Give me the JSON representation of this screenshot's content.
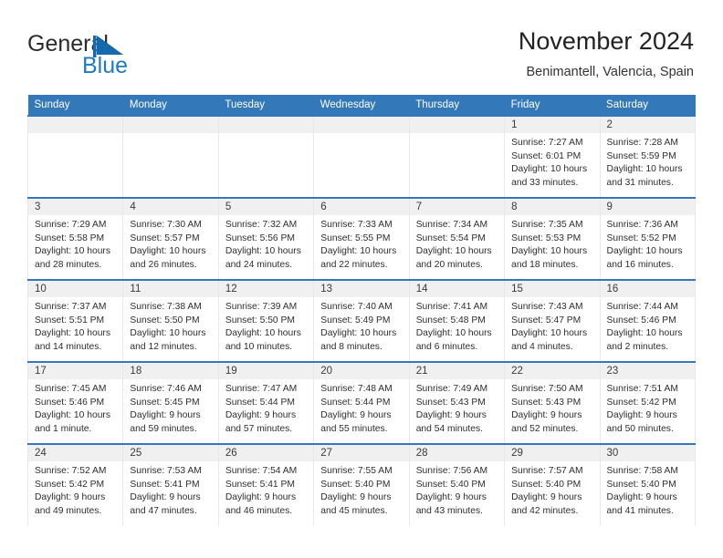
{
  "brand": {
    "name_part1": "General",
    "name_part2": "Blue",
    "accent_color": "#1f7bc1",
    "flag_icon": "blue-triangle-flag-icon"
  },
  "header": {
    "title": "November 2024",
    "subtitle": "Benimantell, Valencia, Spain"
  },
  "theme": {
    "header_blue": "#3378b8",
    "daynum_band": "#f0f0f0",
    "cell_border": "#e8e8e8",
    "text": "#2e2e2e"
  },
  "weekday_headers": [
    "Sunday",
    "Monday",
    "Tuesday",
    "Wednesday",
    "Thursday",
    "Friday",
    "Saturday"
  ],
  "weeks": [
    [
      {
        "empty": true
      },
      {
        "empty": true
      },
      {
        "empty": true
      },
      {
        "empty": true
      },
      {
        "empty": true
      },
      {
        "day": "1",
        "sunrise": "Sunrise: 7:27 AM",
        "sunset": "Sunset: 6:01 PM",
        "daylight_1": "Daylight: 10 hours",
        "daylight_2": "and 33 minutes."
      },
      {
        "day": "2",
        "sunrise": "Sunrise: 7:28 AM",
        "sunset": "Sunset: 5:59 PM",
        "daylight_1": "Daylight: 10 hours",
        "daylight_2": "and 31 minutes."
      }
    ],
    [
      {
        "day": "3",
        "sunrise": "Sunrise: 7:29 AM",
        "sunset": "Sunset: 5:58 PM",
        "daylight_1": "Daylight: 10 hours",
        "daylight_2": "and 28 minutes."
      },
      {
        "day": "4",
        "sunrise": "Sunrise: 7:30 AM",
        "sunset": "Sunset: 5:57 PM",
        "daylight_1": "Daylight: 10 hours",
        "daylight_2": "and 26 minutes."
      },
      {
        "day": "5",
        "sunrise": "Sunrise: 7:32 AM",
        "sunset": "Sunset: 5:56 PM",
        "daylight_1": "Daylight: 10 hours",
        "daylight_2": "and 24 minutes."
      },
      {
        "day": "6",
        "sunrise": "Sunrise: 7:33 AM",
        "sunset": "Sunset: 5:55 PM",
        "daylight_1": "Daylight: 10 hours",
        "daylight_2": "and 22 minutes."
      },
      {
        "day": "7",
        "sunrise": "Sunrise: 7:34 AM",
        "sunset": "Sunset: 5:54 PM",
        "daylight_1": "Daylight: 10 hours",
        "daylight_2": "and 20 minutes."
      },
      {
        "day": "8",
        "sunrise": "Sunrise: 7:35 AM",
        "sunset": "Sunset: 5:53 PM",
        "daylight_1": "Daylight: 10 hours",
        "daylight_2": "and 18 minutes."
      },
      {
        "day": "9",
        "sunrise": "Sunrise: 7:36 AM",
        "sunset": "Sunset: 5:52 PM",
        "daylight_1": "Daylight: 10 hours",
        "daylight_2": "and 16 minutes."
      }
    ],
    [
      {
        "day": "10",
        "sunrise": "Sunrise: 7:37 AM",
        "sunset": "Sunset: 5:51 PM",
        "daylight_1": "Daylight: 10 hours",
        "daylight_2": "and 14 minutes."
      },
      {
        "day": "11",
        "sunrise": "Sunrise: 7:38 AM",
        "sunset": "Sunset: 5:50 PM",
        "daylight_1": "Daylight: 10 hours",
        "daylight_2": "and 12 minutes."
      },
      {
        "day": "12",
        "sunrise": "Sunrise: 7:39 AM",
        "sunset": "Sunset: 5:50 PM",
        "daylight_1": "Daylight: 10 hours",
        "daylight_2": "and 10 minutes."
      },
      {
        "day": "13",
        "sunrise": "Sunrise: 7:40 AM",
        "sunset": "Sunset: 5:49 PM",
        "daylight_1": "Daylight: 10 hours",
        "daylight_2": "and 8 minutes."
      },
      {
        "day": "14",
        "sunrise": "Sunrise: 7:41 AM",
        "sunset": "Sunset: 5:48 PM",
        "daylight_1": "Daylight: 10 hours",
        "daylight_2": "and 6 minutes."
      },
      {
        "day": "15",
        "sunrise": "Sunrise: 7:43 AM",
        "sunset": "Sunset: 5:47 PM",
        "daylight_1": "Daylight: 10 hours",
        "daylight_2": "and 4 minutes."
      },
      {
        "day": "16",
        "sunrise": "Sunrise: 7:44 AM",
        "sunset": "Sunset: 5:46 PM",
        "daylight_1": "Daylight: 10 hours",
        "daylight_2": "and 2 minutes."
      }
    ],
    [
      {
        "day": "17",
        "sunrise": "Sunrise: 7:45 AM",
        "sunset": "Sunset: 5:46 PM",
        "daylight_1": "Daylight: 10 hours",
        "daylight_2": "and 1 minute."
      },
      {
        "day": "18",
        "sunrise": "Sunrise: 7:46 AM",
        "sunset": "Sunset: 5:45 PM",
        "daylight_1": "Daylight: 9 hours",
        "daylight_2": "and 59 minutes."
      },
      {
        "day": "19",
        "sunrise": "Sunrise: 7:47 AM",
        "sunset": "Sunset: 5:44 PM",
        "daylight_1": "Daylight: 9 hours",
        "daylight_2": "and 57 minutes."
      },
      {
        "day": "20",
        "sunrise": "Sunrise: 7:48 AM",
        "sunset": "Sunset: 5:44 PM",
        "daylight_1": "Daylight: 9 hours",
        "daylight_2": "and 55 minutes."
      },
      {
        "day": "21",
        "sunrise": "Sunrise: 7:49 AM",
        "sunset": "Sunset: 5:43 PM",
        "daylight_1": "Daylight: 9 hours",
        "daylight_2": "and 54 minutes."
      },
      {
        "day": "22",
        "sunrise": "Sunrise: 7:50 AM",
        "sunset": "Sunset: 5:43 PM",
        "daylight_1": "Daylight: 9 hours",
        "daylight_2": "and 52 minutes."
      },
      {
        "day": "23",
        "sunrise": "Sunrise: 7:51 AM",
        "sunset": "Sunset: 5:42 PM",
        "daylight_1": "Daylight: 9 hours",
        "daylight_2": "and 50 minutes."
      }
    ],
    [
      {
        "day": "24",
        "sunrise": "Sunrise: 7:52 AM",
        "sunset": "Sunset: 5:42 PM",
        "daylight_1": "Daylight: 9 hours",
        "daylight_2": "and 49 minutes."
      },
      {
        "day": "25",
        "sunrise": "Sunrise: 7:53 AM",
        "sunset": "Sunset: 5:41 PM",
        "daylight_1": "Daylight: 9 hours",
        "daylight_2": "and 47 minutes."
      },
      {
        "day": "26",
        "sunrise": "Sunrise: 7:54 AM",
        "sunset": "Sunset: 5:41 PM",
        "daylight_1": "Daylight: 9 hours",
        "daylight_2": "and 46 minutes."
      },
      {
        "day": "27",
        "sunrise": "Sunrise: 7:55 AM",
        "sunset": "Sunset: 5:40 PM",
        "daylight_1": "Daylight: 9 hours",
        "daylight_2": "and 45 minutes."
      },
      {
        "day": "28",
        "sunrise": "Sunrise: 7:56 AM",
        "sunset": "Sunset: 5:40 PM",
        "daylight_1": "Daylight: 9 hours",
        "daylight_2": "and 43 minutes."
      },
      {
        "day": "29",
        "sunrise": "Sunrise: 7:57 AM",
        "sunset": "Sunset: 5:40 PM",
        "daylight_1": "Daylight: 9 hours",
        "daylight_2": "and 42 minutes."
      },
      {
        "day": "30",
        "sunrise": "Sunrise: 7:58 AM",
        "sunset": "Sunset: 5:40 PM",
        "daylight_1": "Daylight: 9 hours",
        "daylight_2": "and 41 minutes."
      }
    ]
  ]
}
